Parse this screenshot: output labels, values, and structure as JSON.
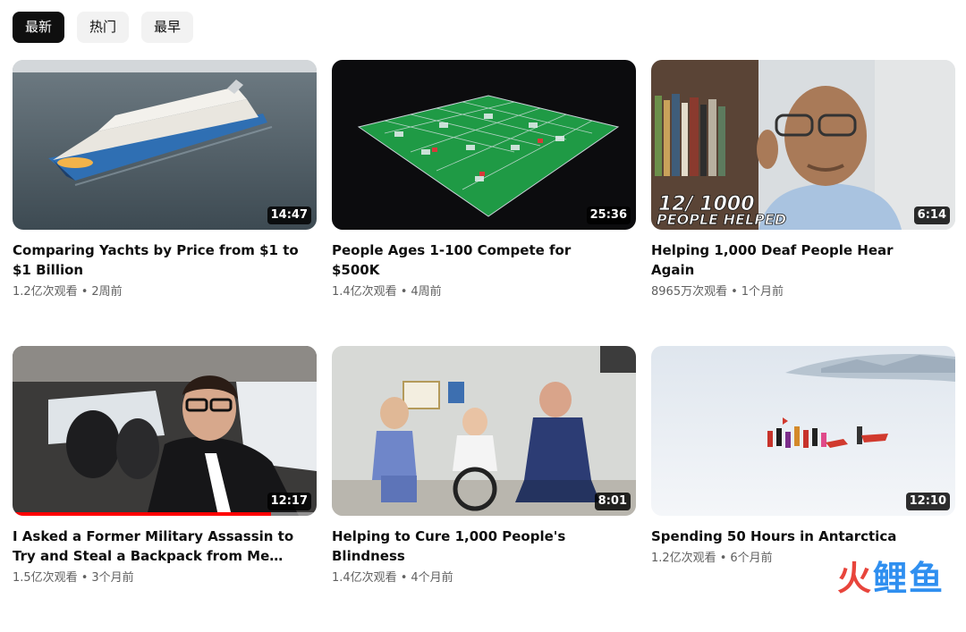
{
  "filters": [
    {
      "label": "最新",
      "active": true
    },
    {
      "label": "热门",
      "active": false
    },
    {
      "label": "最早",
      "active": false
    }
  ],
  "videos": [
    {
      "title": "Comparing Yachts by Price from $1 to $1 Billion",
      "views": "1.2亿次观看",
      "age": "2周前",
      "duration": "14:47",
      "thumb_icon": "cruise-ship-thumbnail",
      "thumb_text": []
    },
    {
      "title": "People Ages 1-100 Compete for $500K",
      "views": "1.4亿次观看",
      "age": "4周前",
      "duration": "25:36",
      "thumb_icon": "arena-cubicles-thumbnail",
      "thumb_text": []
    },
    {
      "title": "Helping 1,000 Deaf People Hear Again",
      "views": "8965万次观看",
      "age": "1个月前",
      "duration": "6:14",
      "thumb_icon": "man-portrait-thumbnail",
      "thumb_text": [
        "12/ 1000",
        "PEOPLE HELPED"
      ]
    },
    {
      "title": "I Asked a Former Military Assassin to Try and Steal a Backpack from Me That...",
      "views": "1.5亿次观看",
      "age": "3个月前",
      "duration": "12:17",
      "thumb_icon": "car-interior-thumbnail",
      "thumb_text": [],
      "watch_progress": 0.85
    },
    {
      "title": "Helping to Cure 1,000 People's Blindness",
      "views": "1.4亿次观看",
      "age": "4个月前",
      "duration": "8:01",
      "thumb_icon": "clinic-thumbnail",
      "thumb_text": []
    },
    {
      "title": "Spending 50 Hours in Antarctica",
      "views": "1.2亿次观看",
      "age": "6个月前",
      "duration": "12:10",
      "thumb_icon": "snow-expedition-thumbnail",
      "thumb_text": []
    }
  ],
  "watermark": {
    "part1": "火",
    "part2": "鲤鱼"
  },
  "colors": {
    "chip_active": "#0f0f0f",
    "chip": "#f2f2f2",
    "meta_text": "#606060",
    "progress": "#ff0000"
  }
}
